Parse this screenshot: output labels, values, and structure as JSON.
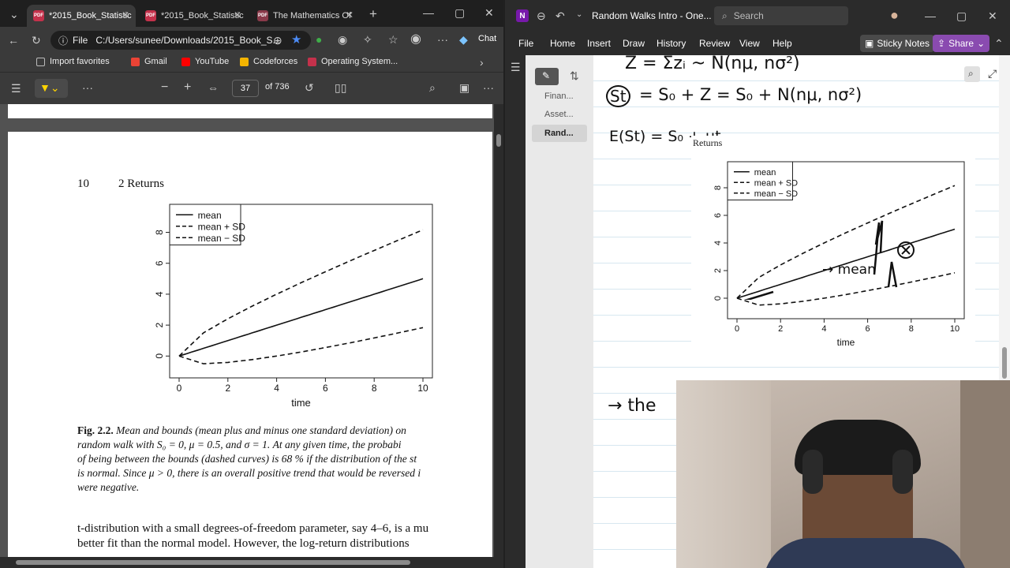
{
  "browser": {
    "tabs": [
      {
        "title": "*2015_Book_Statistic",
        "close": "✕"
      },
      {
        "title": "*2015_Book_Statistic",
        "close": "✕"
      },
      {
        "title": "The Mathematics Of",
        "close": "✕"
      }
    ],
    "new_tab": "+",
    "window_controls": {
      "minimize": "—",
      "maximize": "▢",
      "close": "✕"
    },
    "address": {
      "label": "File",
      "url": "C:/Users/sunee/Downloads/2015_Book_S..."
    },
    "chat_label": "Chat",
    "favorites": [
      {
        "label": "Import favorites",
        "color": "#bbbbbb"
      },
      {
        "label": "Gmail",
        "color": "#ea4335"
      },
      {
        "label": "YouTube",
        "color": "#ff0000"
      },
      {
        "label": "Codeforces",
        "color": "#f4b400"
      },
      {
        "label": "Operating System...",
        "color": "#c4314b"
      }
    ],
    "favorites_more": "›",
    "pdf_toolbar": {
      "zoom_out": "−",
      "zoom_in": "+",
      "page": "37",
      "page_total": "of 736"
    }
  },
  "pdf_page": {
    "page_number": "10",
    "section": "2 Returns",
    "caption_label": "Fig. 2.2.",
    "caption_lines": [
      "Mean and bounds (mean plus and minus one standard deviation) on",
      "random walk with S₀ = 0, μ = 0.5, and σ = 1. At any given time, the probabi",
      "of being between the bounds (dashed curves) is 68 % if the distribution of the st",
      "is normal. Since μ > 0, there is an overall positive trend that would be reversed i",
      "were negative."
    ],
    "body_lines": [
      "t-distribution with a small degrees-of-freedom parameter, say 4–6, is a mu",
      "better fit than the normal model. However, the log-return distributions"
    ]
  },
  "chart_data": [
    {
      "type": "line",
      "title": "",
      "xlabel": "time",
      "ylabel": "",
      "xlim": [
        0,
        10
      ],
      "ylim": [
        -0.8,
        9.2
      ],
      "xticks": [
        "0",
        "2",
        "4",
        "6",
        "8",
        "10"
      ],
      "yticks": [
        "0",
        "2",
        "4",
        "6",
        "8"
      ],
      "legend": [
        "mean",
        "mean + SD",
        "mean − SD"
      ],
      "legend_position": "top-left",
      "x": [
        0,
        1,
        2,
        3,
        4,
        5,
        6,
        7,
        8,
        9,
        10
      ],
      "series": [
        {
          "name": "mean",
          "style": "solid",
          "values": [
            0,
            0.5,
            1,
            1.5,
            2,
            2.5,
            3,
            3.5,
            4,
            4.5,
            5
          ]
        },
        {
          "name": "mean + SD",
          "style": "dashed",
          "values": [
            0,
            1.5,
            2.41,
            3.23,
            4,
            4.74,
            5.45,
            6.15,
            6.83,
            7.5,
            8.16
          ]
        },
        {
          "name": "mean − SD",
          "style": "dashed",
          "values": [
            0,
            -0.5,
            -0.41,
            -0.23,
            0,
            0.26,
            0.55,
            0.85,
            1.17,
            1.5,
            1.84
          ]
        }
      ]
    },
    {
      "type": "line",
      "title": "Returns",
      "xlabel": "time",
      "ylabel": "",
      "xlim": [
        0,
        10
      ],
      "ylim": [
        -0.8,
        9.2
      ],
      "xticks": [
        "0",
        "2",
        "4",
        "6",
        "8",
        "10"
      ],
      "yticks": [
        "0",
        "2",
        "4",
        "6",
        "8"
      ],
      "legend": [
        "mean",
        "mean + SD",
        "mean − SD"
      ],
      "legend_position": "top-left",
      "x": [
        0,
        1,
        2,
        3,
        4,
        5,
        6,
        7,
        8,
        9,
        10
      ],
      "series": [
        {
          "name": "mean",
          "style": "solid",
          "values": [
            0,
            0.5,
            1,
            1.5,
            2,
            2.5,
            3,
            3.5,
            4,
            4.5,
            5
          ]
        },
        {
          "name": "mean + SD",
          "style": "dashed",
          "values": [
            0,
            1.5,
            2.41,
            3.23,
            4,
            4.74,
            5.45,
            6.15,
            6.83,
            7.5,
            8.16
          ]
        },
        {
          "name": "mean − SD",
          "style": "dashed",
          "values": [
            0,
            -0.5,
            -0.41,
            -0.23,
            0,
            0.26,
            0.55,
            0.85,
            1.17,
            1.5,
            1.84
          ]
        }
      ]
    }
  ],
  "onenote": {
    "app_icon": "N",
    "title": "Random Walks Intro - One...",
    "search_placeholder": "Search",
    "window_controls": {
      "minimize": "—",
      "maximize": "▢",
      "close": "✕"
    },
    "menu": [
      "File",
      "Home",
      "Insert",
      "Draw",
      "History",
      "Review",
      "View",
      "Help"
    ],
    "sticky_notes": "Sticky Notes",
    "share": "Share",
    "pages": [
      "Finan...",
      "Asset...",
      "Rand..."
    ],
    "ink": {
      "line1": "Z = Σzᵢ ~ N(nμ, nσ²)",
      "line2_circled": "St",
      "line2_rest": "= S₀ + Z  = S₀ + N(nμ, nσ²)",
      "line3": "E(St) = S₀ + μt",
      "mean_note": "→ mean",
      "the_note": "→ the"
    }
  }
}
